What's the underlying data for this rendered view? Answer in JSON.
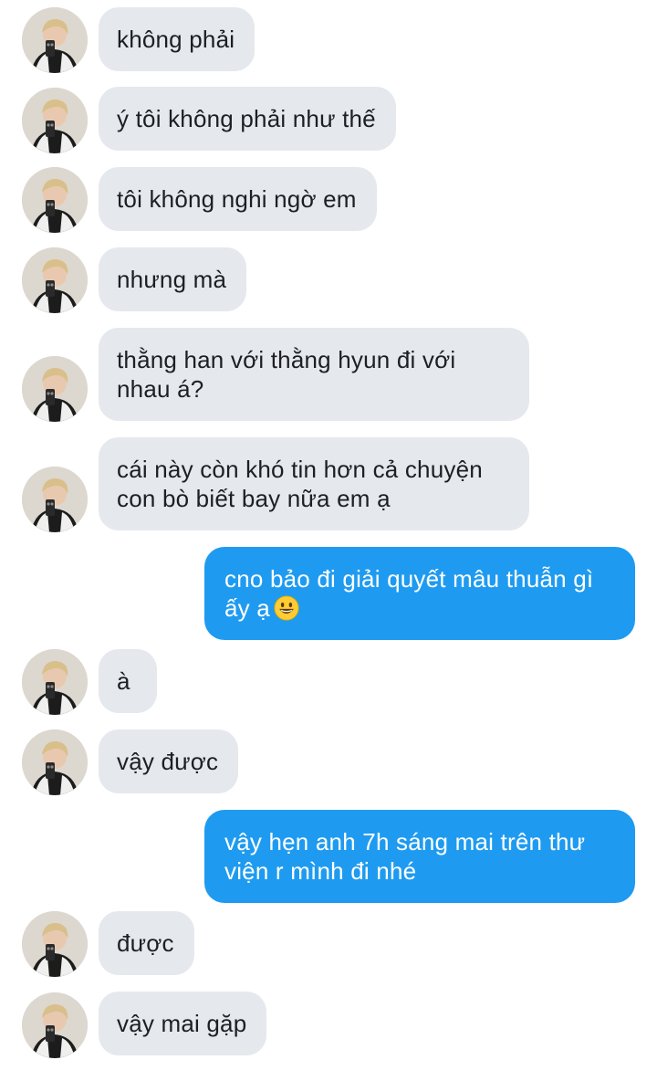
{
  "messages": [
    {
      "from": "them",
      "text": "không phải"
    },
    {
      "from": "them",
      "text": "ý tôi không phải như thế"
    },
    {
      "from": "them",
      "text": "tôi không nghi ngờ em"
    },
    {
      "from": "them",
      "text": "nhưng mà"
    },
    {
      "from": "them",
      "text": "thằng han với thằng hyun đi với nhau á?"
    },
    {
      "from": "them",
      "text": "cái này còn khó tin hơn cả chuyện con bò biết bay nữa em ạ"
    },
    {
      "from": "me",
      "text": "cno bảo đi giải quyết mâu thuẫn gì ấy ạ",
      "emoji": "grinning-face"
    },
    {
      "from": "them",
      "text": "à"
    },
    {
      "from": "them",
      "text": "vậy được"
    },
    {
      "from": "me",
      "text": "vậy hẹn anh 7h sáng mai trên thư viện r mình đi nhé"
    },
    {
      "from": "them",
      "text": "được"
    },
    {
      "from": "them",
      "text": "vậy mai gặp"
    }
  ],
  "colors": {
    "incoming_bubble": "#e5e8ec",
    "outgoing_bubble": "#1e9bf0",
    "incoming_text": "#1d1f22",
    "outgoing_text": "#ffffff"
  }
}
